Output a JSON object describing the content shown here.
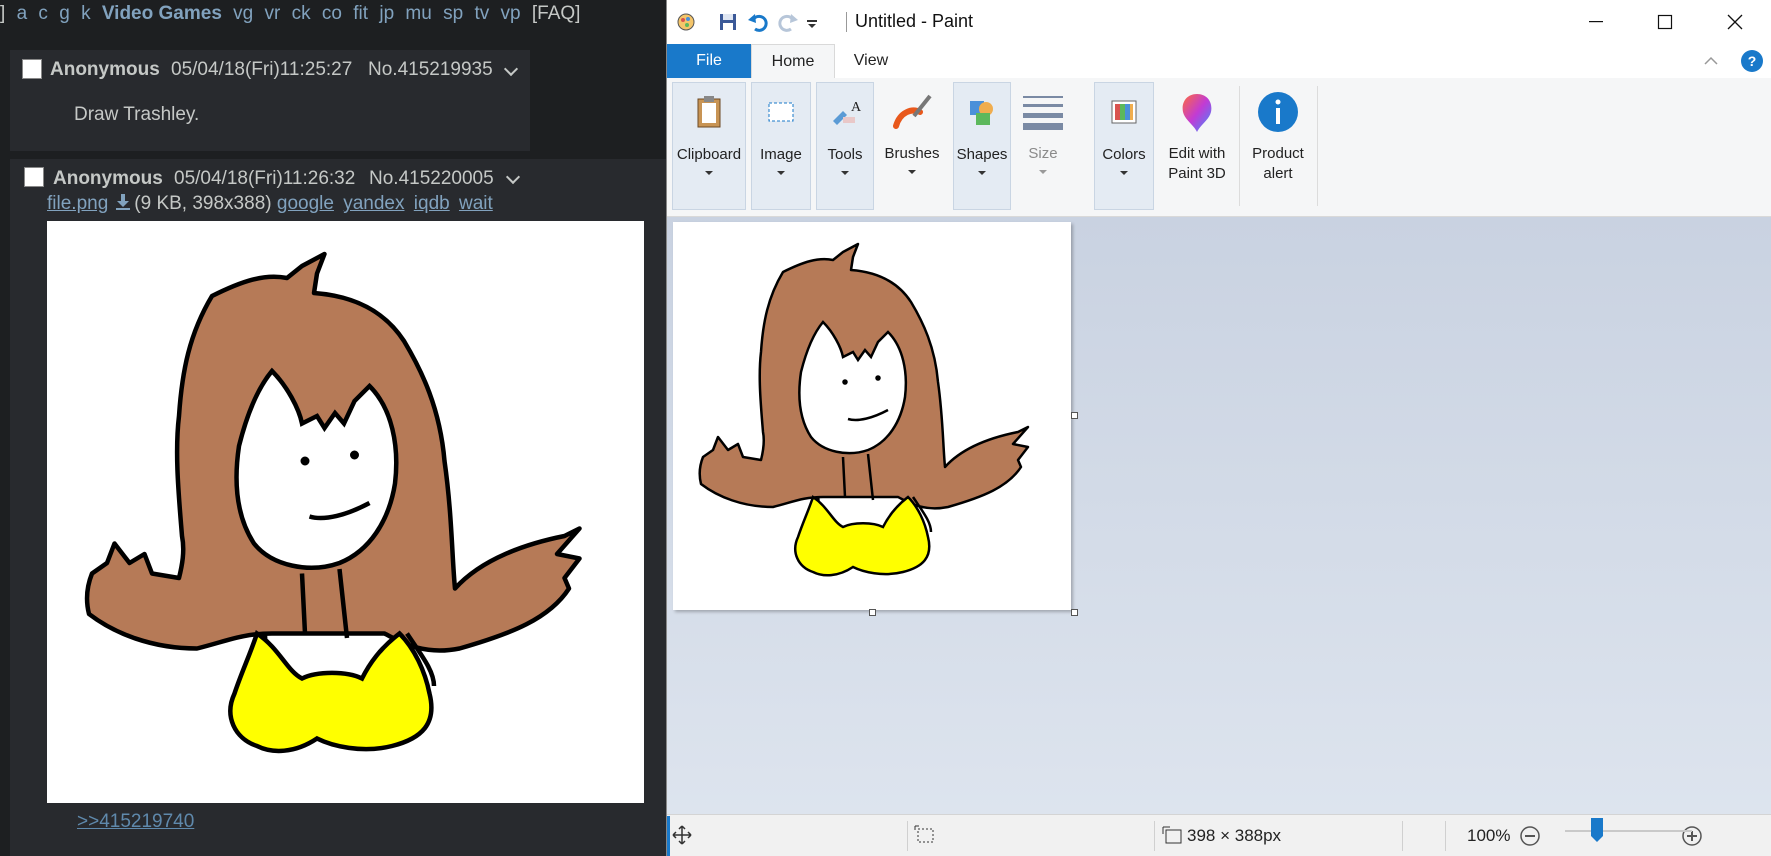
{
  "board": {
    "nav": {
      "lead": "] ",
      "links": [
        "a",
        "c",
        "g",
        "k"
      ],
      "current": "Video Games",
      "links2": [
        "vg",
        "vr",
        "ck",
        "co",
        "fit",
        "jp",
        "mu",
        "sp",
        "tv",
        "vp"
      ],
      "faq": "[FAQ]"
    },
    "post1": {
      "name": "Anonymous",
      "datetime": "05/04/18(Fri)11:25:27",
      "number": "No.415219935",
      "message": "Draw Trashley."
    },
    "post2": {
      "name": "Anonymous",
      "datetime": "05/04/18(Fri)11:26:32",
      "number": "No.415220005",
      "filename": "file.png",
      "fileinfo": "(9 KB, 398x388)",
      "search_links": [
        "google",
        "yandex",
        "iqdb",
        "wait"
      ],
      "quote": ">>415219740"
    }
  },
  "paint": {
    "title": "Untitled - Paint",
    "tabs": {
      "file": "File",
      "home": "Home",
      "view": "View"
    },
    "ribbon": [
      {
        "label": "Clipboard",
        "icon": "clipboard-icon"
      },
      {
        "label": "Image",
        "icon": "select-icon"
      },
      {
        "label": "Tools",
        "icon": "tools-icon"
      },
      {
        "label": "Brushes",
        "icon": "brush-icon"
      },
      {
        "label": "Shapes",
        "icon": "shapes-icon"
      },
      {
        "label": "Size",
        "icon": "size-icon"
      },
      {
        "label": "Colors",
        "icon": "colors-icon"
      },
      {
        "label": "Edit with Paint 3D",
        "icon": "paint3d-icon"
      },
      {
        "label": "Product alert",
        "icon": "info-icon"
      }
    ],
    "status": {
      "dimensions": "398 × 388px",
      "zoom": "100%"
    },
    "colors": {
      "accent": "#1979ca",
      "hair": "#b67a57",
      "shirt": "#ffff00"
    }
  }
}
